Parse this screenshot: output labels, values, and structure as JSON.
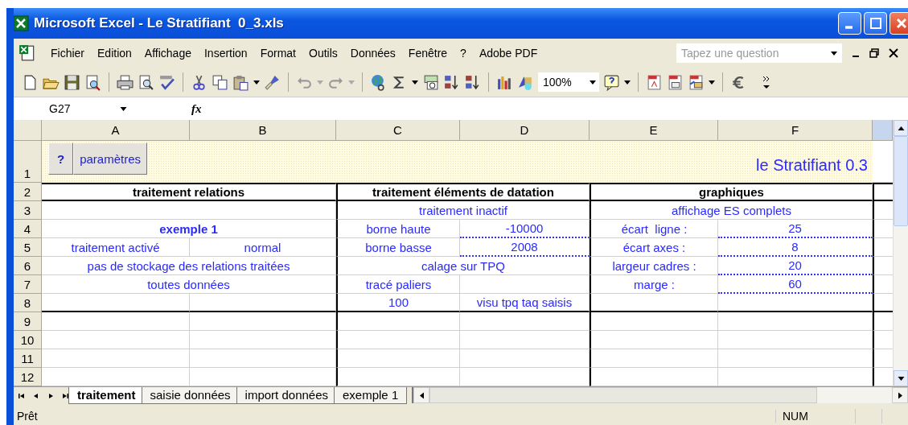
{
  "window": {
    "title": "Microsoft Excel - Le Stratifiant  0_3.xls"
  },
  "menu": [
    "Fichier",
    "Edition",
    "Affichage",
    "Insertion",
    "Format",
    "Outils",
    "Données",
    "Fenêtre",
    "?",
    "Adobe PDF"
  ],
  "help_box": {
    "placeholder": "Tapez une question"
  },
  "toolbar": {
    "zoom": "100%"
  },
  "formula_bar": {
    "name_box": "G27",
    "fx": "fx"
  },
  "columns": [
    "A",
    "B",
    "C",
    "D",
    "E",
    "F"
  ],
  "banner": {
    "buttons": [
      "?",
      "paramètres"
    ],
    "title": "le Stratifiant 0.3"
  },
  "rows": [
    {
      "header": "1"
    },
    {
      "header": "2",
      "cells": [
        {
          "text": "traitement relations",
          "kind": "heading"
        },
        {
          "text": "traitement éléments de datation",
          "kind": "heading"
        },
        {
          "text": "graphiques",
          "kind": "heading"
        }
      ]
    },
    {
      "header": "3",
      "cells": [
        {},
        {
          "text": "traitement inactif",
          "kind": "value"
        },
        {
          "text": "affichage ES complets",
          "kind": "value"
        }
      ]
    },
    {
      "header": "4",
      "cells": [
        {
          "text": "exemple 1",
          "kind": "strong"
        },
        {
          "text": "borne haute",
          "kind": "value"
        },
        {
          "text": "-10000",
          "kind": "input"
        },
        {
          "text": "écart  ligne :",
          "kind": "value"
        },
        {
          "text": "25",
          "kind": "input"
        }
      ]
    },
    {
      "header": "5",
      "cells": [
        {
          "text": "traitement activé",
          "kind": "value"
        },
        {
          "text": "normal",
          "kind": "value"
        },
        {
          "text": "borne basse",
          "kind": "value"
        },
        {
          "text": "2008",
          "kind": "input"
        },
        {
          "text": "écart axes :",
          "kind": "value"
        },
        {
          "text": "8",
          "kind": "input"
        }
      ]
    },
    {
      "header": "6",
      "cells": [
        {
          "text": "pas de stockage des relations traitées",
          "kind": "value"
        },
        {
          "text": "calage sur TPQ",
          "kind": "value"
        },
        {
          "text": "largeur cadres :",
          "kind": "value"
        },
        {
          "text": "20",
          "kind": "input"
        }
      ]
    },
    {
      "header": "7",
      "cells": [
        {
          "text": "toutes données",
          "kind": "value"
        },
        {
          "text": "tracé paliers",
          "kind": "value"
        },
        {},
        {
          "text": "marge :",
          "kind": "value"
        },
        {
          "text": "60",
          "kind": "input"
        }
      ]
    },
    {
      "header": "8",
      "cells": [
        {},
        {},
        {
          "text": "100",
          "kind": "value"
        },
        {
          "text": "visu tpq taq saisis",
          "kind": "value"
        },
        {},
        {}
      ]
    },
    {
      "header": "9",
      "cells": [
        {},
        {},
        {},
        {},
        {},
        {}
      ]
    },
    {
      "header": "10",
      "cells": [
        {},
        {},
        {},
        {},
        {},
        {}
      ]
    },
    {
      "header": "11",
      "cells": [
        {},
        {},
        {},
        {},
        {},
        {}
      ]
    },
    {
      "header": "12",
      "cells": [
        {},
        {},
        {},
        {},
        {},
        {}
      ]
    }
  ],
  "sheet_tabs": [
    {
      "label": "traitement",
      "selected": true
    },
    {
      "label": "saisie données",
      "selected": false
    },
    {
      "label": "import données",
      "selected": false
    },
    {
      "label": "exemple 1",
      "selected": false
    }
  ],
  "status_bar": {
    "state": "Prêt",
    "num": "NUM"
  }
}
